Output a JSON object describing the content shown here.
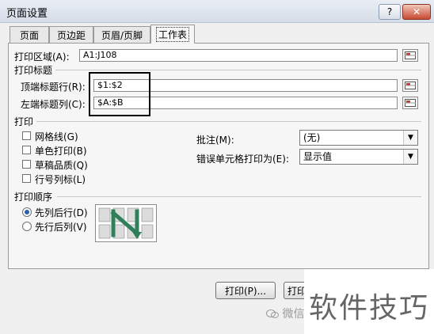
{
  "window": {
    "title": "页面设置",
    "help": "?",
    "close": "✕"
  },
  "tabs": [
    {
      "label": "页面"
    },
    {
      "label": "页边距"
    },
    {
      "label": "页眉/页脚"
    },
    {
      "label": "工作表",
      "active": true
    }
  ],
  "print_area": {
    "label": "打印区域(A):",
    "value": "A1:J108"
  },
  "print_titles": {
    "section": "打印标题",
    "top_rows_label": "顶端标题行(R):",
    "top_rows_value": "$1:$2",
    "left_cols_label": "左端标题列(C):",
    "left_cols_value": "$A:$B"
  },
  "print": {
    "section": "打印",
    "checkboxes": [
      {
        "label": "网格线(G)",
        "checked": false
      },
      {
        "label": "单色打印(B)",
        "checked": false
      },
      {
        "label": "草稿品质(Q)",
        "checked": false
      },
      {
        "label": "行号列标(L)",
        "checked": false
      }
    ],
    "comments_label": "批注(M):",
    "comments_value": "(无)",
    "errors_label": "错误单元格打印为(E):",
    "errors_value": "显示值"
  },
  "page_order": {
    "section": "打印顺序",
    "options": [
      {
        "label": "先列后行(D)",
        "selected": true
      },
      {
        "label": "先行后列(V)",
        "selected": false
      }
    ]
  },
  "buttons": {
    "print": "打印(P)...",
    "print2": "打印"
  },
  "watermark": {
    "brand": "软件技巧",
    "wechat": "微信"
  },
  "colors": {
    "highlight_border": "#000000",
    "arrow_green": "#2f7f5a"
  }
}
